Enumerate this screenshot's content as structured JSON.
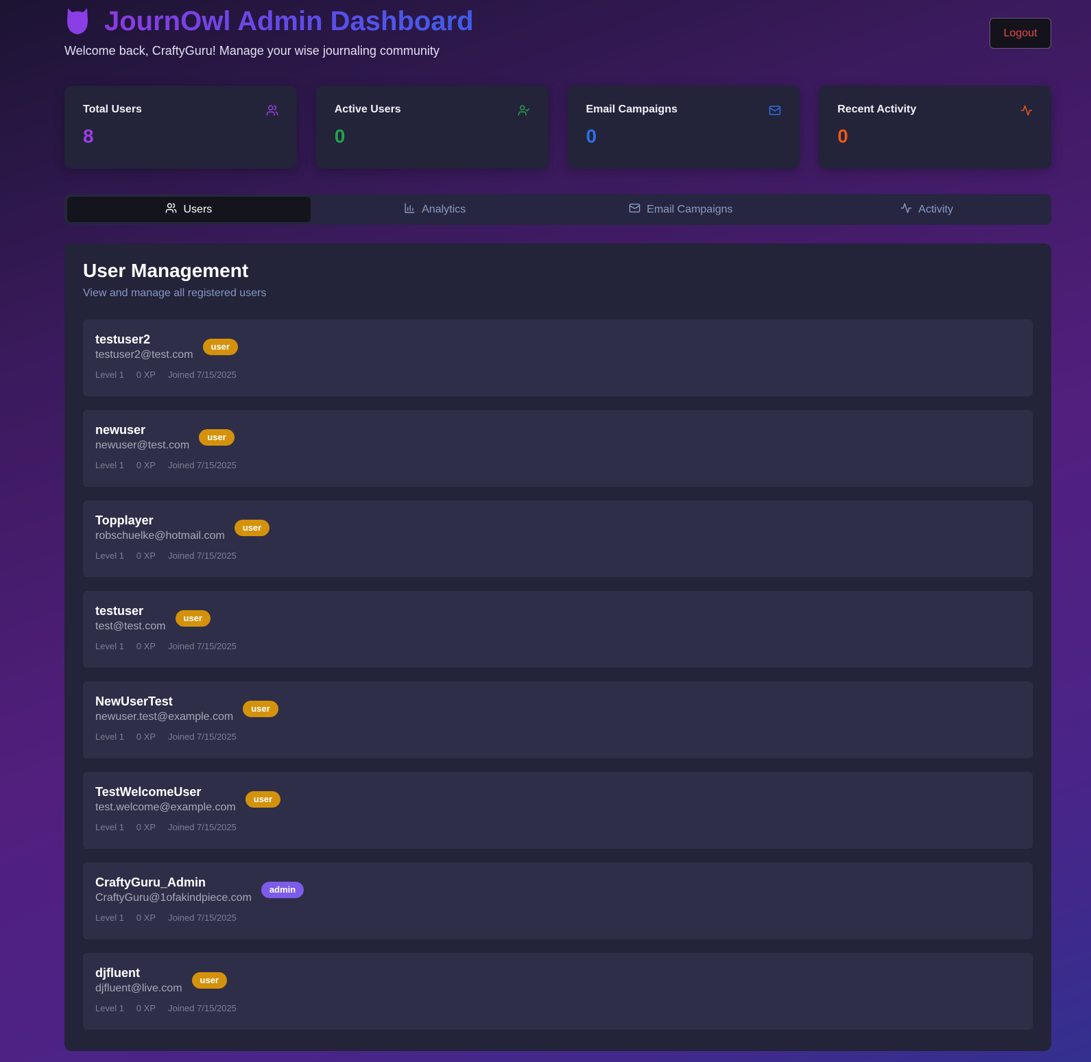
{
  "header": {
    "title": "JournOwl Admin Dashboard",
    "welcome": "Welcome back, CraftyGuru! Manage your wise journaling community",
    "logout_label": "Logout",
    "logo_icon": "owl-icon"
  },
  "stats": [
    {
      "label": "Total Users",
      "value": "8",
      "icon": "users-icon",
      "color": "#9b3fe8"
    },
    {
      "label": "Active Users",
      "value": "0",
      "icon": "user-check-icon",
      "color": "#21a54a"
    },
    {
      "label": "Email Campaigns",
      "value": "0",
      "icon": "mail-icon",
      "color": "#2f6fe4"
    },
    {
      "label": "Recent Activity",
      "value": "0",
      "icon": "activity-icon",
      "color": "#e8591a"
    }
  ],
  "tabs": [
    {
      "label": "Users",
      "icon": "users-icon",
      "active": true
    },
    {
      "label": "Analytics",
      "icon": "bar-chart-icon",
      "active": false
    },
    {
      "label": "Email Campaigns",
      "icon": "mail-icon",
      "active": false
    },
    {
      "label": "Activity",
      "icon": "activity-icon",
      "active": false
    }
  ],
  "panel": {
    "title": "User Management",
    "subtitle": "View and manage all registered users"
  },
  "users": [
    {
      "name": "testuser2",
      "email": "testuser2@test.com",
      "role": "user",
      "level": "Level 1",
      "xp": "0 XP",
      "joined": "Joined 7/15/2025"
    },
    {
      "name": "newuser",
      "email": "newuser@test.com",
      "role": "user",
      "level": "Level 1",
      "xp": "0 XP",
      "joined": "Joined 7/15/2025"
    },
    {
      "name": "Topplayer",
      "email": "robschuelke@hotmail.com",
      "role": "user",
      "level": "Level 1",
      "xp": "0 XP",
      "joined": "Joined 7/15/2025"
    },
    {
      "name": "testuser",
      "email": "test@test.com",
      "role": "user",
      "level": "Level 1",
      "xp": "0 XP",
      "joined": "Joined 7/15/2025"
    },
    {
      "name": "NewUserTest",
      "email": "newuser.test@example.com",
      "role": "user",
      "level": "Level 1",
      "xp": "0 XP",
      "joined": "Joined 7/15/2025"
    },
    {
      "name": "TestWelcomeUser",
      "email": "test.welcome@example.com",
      "role": "user",
      "level": "Level 1",
      "xp": "0 XP",
      "joined": "Joined 7/15/2025"
    },
    {
      "name": "CraftyGuru_Admin",
      "email": "CraftyGuru@1ofakindpiece.com",
      "role": "admin",
      "level": "Level 1",
      "xp": "0 XP",
      "joined": "Joined 7/15/2025"
    },
    {
      "name": "djfluent",
      "email": "djfluent@live.com",
      "role": "user",
      "level": "Level 1",
      "xp": "0 XP",
      "joined": "Joined 7/15/2025"
    }
  ]
}
